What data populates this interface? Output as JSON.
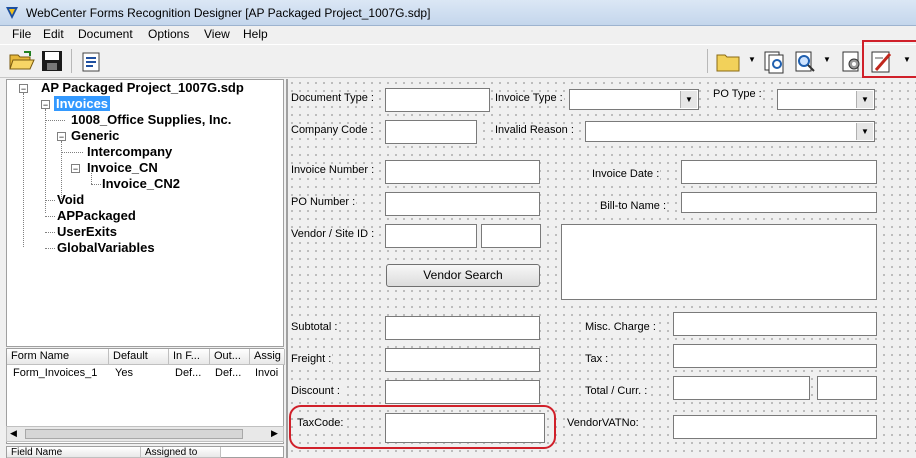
{
  "window": {
    "title": "WebCenter Forms Recognition Designer [AP Packaged Project_1007G.sdp]"
  },
  "menu": [
    "File",
    "Edit",
    "Document",
    "Options",
    "View",
    "Help"
  ],
  "tree": {
    "root": "AP Packaged Project_1007G.sdp",
    "nodes": [
      "Invoices",
      "1008_Office Supplies, Inc.",
      "Generic",
      "Intercompany",
      "Invoice_CN",
      "Invoice_CN2",
      "Void",
      "APPackaged",
      "UserExits",
      "GlobalVariables"
    ]
  },
  "form_list": {
    "headers": [
      "Form Name",
      "Default",
      "In F...",
      "Out...",
      "Assig"
    ],
    "row": [
      "Form_Invoices_1",
      "Yes",
      "Def...",
      "Def...",
      "Invoi"
    ]
  },
  "field_list": {
    "headers": [
      "Field Name",
      "Assigned to"
    ]
  },
  "form": {
    "document_type": "Document Type :",
    "invoice_type": "Invoice Type :",
    "po_type": "PO Type :",
    "company_code": "Company Code :",
    "invalid_reason": "Invalid Reason :",
    "invoice_number": "Invoice Number :",
    "invoice_date": "Invoice Date :",
    "po_number": "PO Number :",
    "bill_to_name": "Bill-to Name :",
    "vendor_site_id": "Vendor / Site ID :",
    "vendor_search": "Vendor Search",
    "subtotal": "Subtotal :",
    "misc_charge": "Misc. Charge :",
    "freight": "Freight :",
    "tax": "Tax :",
    "discount": "Discount :",
    "total_curr": "Total / Curr. :",
    "taxcode": "TaxCode:",
    "vendor_vat_no": "VendorVATNo:"
  },
  "colors": {
    "selection": "#3399ff",
    "highlight_ring": "#d0202a"
  }
}
